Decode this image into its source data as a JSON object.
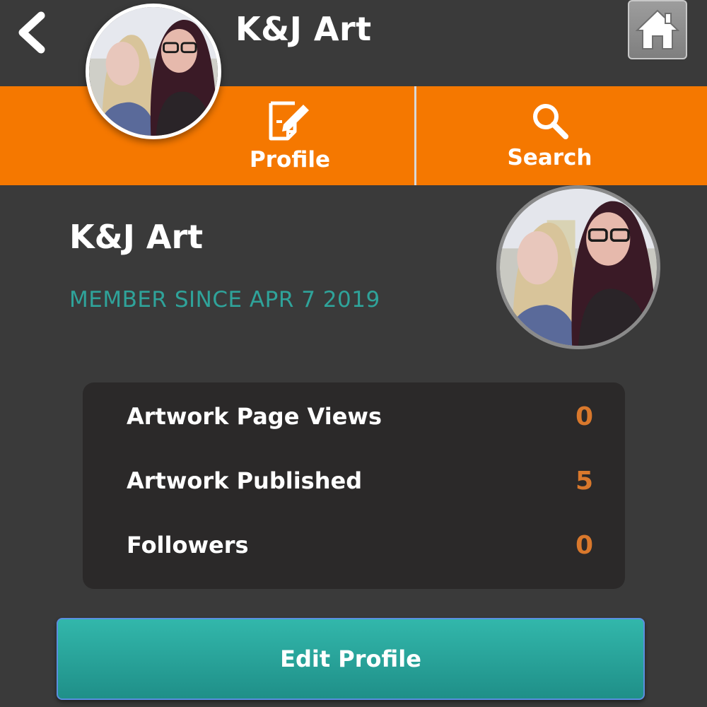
{
  "header": {
    "title": "K&J Art",
    "back_icon": "chevron-left-icon",
    "home_icon": "home-icon"
  },
  "nav": {
    "items": [
      {
        "label": "Profile",
        "icon": "edit-note-icon"
      },
      {
        "label": "Search",
        "icon": "search-icon"
      }
    ]
  },
  "profile": {
    "name": "K&J Art",
    "member_since": "MEMBER SINCE APR 7 2019"
  },
  "stats": [
    {
      "label": "Artwork Page Views",
      "value": "0"
    },
    {
      "label": "Artwork Published",
      "value": "5"
    },
    {
      "label": "Followers",
      "value": "0"
    }
  ],
  "actions": {
    "edit_profile": "Edit Profile"
  },
  "colors": {
    "background": "#3a3a3a",
    "nav_orange": "#f57800",
    "accent_teal": "#2fa39a",
    "stat_value": "#d9782c",
    "button_teal": "#26a39a"
  }
}
